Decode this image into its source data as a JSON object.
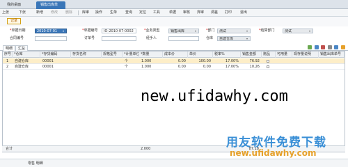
{
  "tabs": [
    {
      "label": "我的桌面"
    },
    {
      "label": "销售出库单"
    }
  ],
  "toolbar": {
    "items": [
      "上张",
      "下张",
      "新增",
      "修改",
      "删除",
      "库审",
      "操作",
      "生单",
      "查询",
      "定位",
      "工具",
      "单据",
      "审核",
      "弃审",
      "调差",
      "打印",
      "退出"
    ]
  },
  "refresh_label": "记录",
  "form": {
    "date_label": "单据日期",
    "date_value": "2010-07-01",
    "doc_no_label": "单据编号",
    "doc_no_value": "IO-2010-07-0002",
    "biz_type_label": "业务类型",
    "biz_type_value": "销售出库",
    "dept_label": "部门",
    "dept_value": "测试",
    "delivery_dept_label": "结算部门",
    "delivery_dept_value": "测试",
    "contract_label": "合同编号",
    "contract_value": "",
    "order_no_label": "订单号",
    "order_no_value": "",
    "handler_label": "经手人",
    "handler_value": "",
    "warehouse_label": "仓库",
    "warehouse_value": "自建仓库"
  },
  "subtabs": [
    {
      "label": "明细"
    },
    {
      "label": "汇总"
    }
  ],
  "grid": {
    "headers": [
      "序号",
      "*仓库",
      "*存货编码",
      "存货名称",
      "规格型号",
      "*计量单位",
      "*数量",
      "成本价",
      "单价",
      "税率%",
      "销售金额",
      "赠品",
      "可用量",
      "现存量说明",
      "销售出库单号"
    ],
    "rows": [
      {
        "no": "1",
        "wh": "自建仓库",
        "code": "00001",
        "name": "",
        "spec": "",
        "unit": "个",
        "qty": "1.000",
        "cost": "0.00",
        "price": "100.00",
        "tax": "17.00%",
        "amount": "76.92"
      },
      {
        "no": "2",
        "wh": "自建仓库",
        "code": "00001",
        "name": "",
        "spec": "",
        "unit": "个",
        "qty": "1.000",
        "cost": "0.00",
        "price": "0.00",
        "tax": "17.00%",
        "amount": "10.26"
      }
    ],
    "total_label": "合计",
    "total_qty": "2.000",
    "total_amount": "87.18"
  },
  "status": {
    "text": "零售 明细"
  },
  "watermark": {
    "url": "new.ufidawhy.com",
    "cn": "用友软件免费下载",
    "url2": "new.ufidawhy.com"
  },
  "colors": {
    "accent": "#3a76b8",
    "highlight_row": "#fdeec8",
    "watermark_cn": "#3a8fd6",
    "watermark_url2": "#e6a12b"
  },
  "icons": [
    "tab-close-icon",
    "dropdown-arrow-icon",
    "add-row-icon",
    "delete-row-icon",
    "copy-row-icon",
    "settings-icon",
    "export-icon"
  ]
}
